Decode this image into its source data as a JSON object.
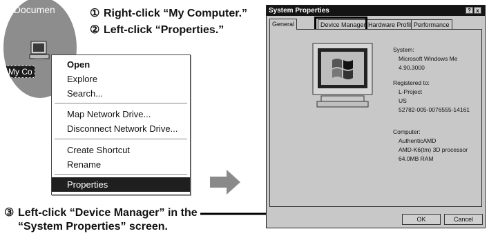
{
  "desktop": {
    "top_label": "y Documen",
    "icon_label": "My Co"
  },
  "steps": [
    {
      "num": "①",
      "text": "Right-click “My Computer.”"
    },
    {
      "num": "②",
      "text": "Left-click “Properties.”"
    },
    {
      "num": "③",
      "text": "Left-click “Device Manager” in the"
    },
    {
      "num": "",
      "text": "“System Properties” screen."
    }
  ],
  "context_menu": {
    "items": [
      {
        "label": "Open",
        "bold": true
      },
      {
        "label": "Explore"
      },
      {
        "label": "Search..."
      },
      {
        "label": "Map Network Drive..."
      },
      {
        "label": "Disconnect Network Drive..."
      },
      {
        "label": "Create Shortcut"
      },
      {
        "label": "Rename"
      },
      {
        "label": "Properties",
        "selected": true
      }
    ]
  },
  "dialog": {
    "title": "System Properties",
    "help_button": "?",
    "close_button": "x",
    "tabs": [
      "General",
      "Device Manager",
      "Hardware Profiles",
      "Performance"
    ],
    "system_label": "System:",
    "system_lines": [
      "Microsoft Windows Me",
      "4.90.3000"
    ],
    "registered_label": "Registered to:",
    "registered_lines": [
      "L-Project",
      "US",
      "52782-005-0076555-14161"
    ],
    "computer_label": "Computer:",
    "computer_lines": [
      "AuthenticAMD",
      "AMD-K6(tm) 3D processor",
      "64.0MB RAM"
    ],
    "ok_label": "OK",
    "cancel_label": "Cancel"
  },
  "icons": [
    "my-computer-icon",
    "windows-logo-icon",
    "right-arrow-icon"
  ],
  "colors": {
    "dialog_bg": "#c8c8c8",
    "titlebar": "#141414",
    "menu_selected": "#1f1f1f",
    "desktop": "#8d8d8d"
  }
}
